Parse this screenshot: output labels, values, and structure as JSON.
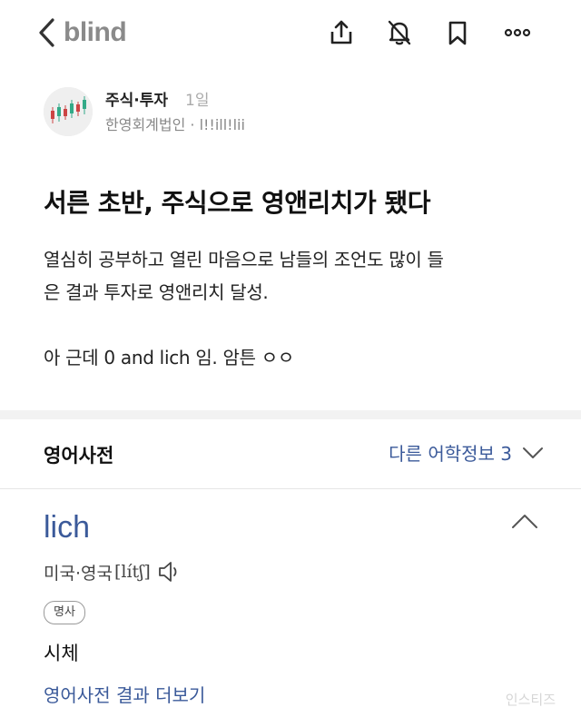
{
  "topbar": {
    "brand": "blind",
    "icons": [
      "back-chevron-icon",
      "share-icon",
      "notifications-off-icon",
      "bookmark-icon",
      "more-icon"
    ]
  },
  "post": {
    "board": "주식·투자",
    "time": "1일",
    "company": "한영회계법인 · l!!ill!lii",
    "title": "서른 초반, 주식으로 영앤리치가 됐다",
    "body_line1": "열심히 공부하고 열린 마음으로 남들의 조언도 많이 들",
    "body_line2": "은 결과 투자로 영앤리치 달성.",
    "body_line3": "아 근데 0 and lich 임. 암튼 ㅇㅇ"
  },
  "dictionary": {
    "label": "영어사전",
    "more_info": "다른 어학정보 3",
    "word": "lich",
    "pron_region": "미국·영국",
    "ipa": "[lítʃ]",
    "pos": "명사",
    "meaning": "시체",
    "more_link": "영어사전 결과 더보기"
  },
  "watermark": "인스티즈",
  "colors": {
    "accent": "#3b5a9a",
    "divider": "#f2f2f2",
    "brand_gray": "#8a8a8a"
  }
}
